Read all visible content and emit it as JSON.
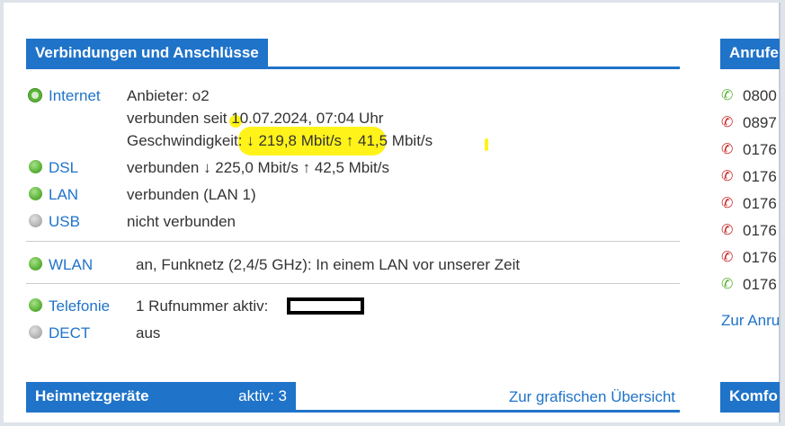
{
  "connections": {
    "title": "Verbindungen und Anschlüsse",
    "internet": {
      "label": "Internet",
      "provider": "Anbieter: o2",
      "since": "verbunden seit 10.07.2024, 07:04 Uhr",
      "speed": "Geschwindigkeit: ↓ 219,8 Mbit/s ↑ 41,5 Mbit/s"
    },
    "dsl": {
      "label": "DSL",
      "status": "verbunden ↓ 225,0 Mbit/s ↑ 42,5 Mbit/s"
    },
    "lan": {
      "label": "LAN",
      "status": "verbunden (LAN 1)"
    },
    "usb": {
      "label": "USB",
      "status": "nicht verbunden"
    },
    "wlan": {
      "label": "WLAN",
      "status": "an, Funknetz (2,4/5 GHz): In einem LAN vor unserer Zeit"
    },
    "telefonie": {
      "label": "Telefonie",
      "status": "1 Rufnummer aktiv:"
    },
    "dect": {
      "label": "DECT",
      "status": "aus"
    }
  },
  "home_network": {
    "title": "Heimnetzgeräte",
    "active": "aktiv: 3",
    "overview_link": "Zur grafischen Übersicht"
  },
  "calls": {
    "title": "Anrufe",
    "items": [
      {
        "number": "0800",
        "type": "incoming",
        "icon": "phone-incoming-icon"
      },
      {
        "number": "0897",
        "type": "missed",
        "icon": "phone-missed-icon"
      },
      {
        "number": "0176",
        "type": "missed",
        "icon": "phone-missed-icon"
      },
      {
        "number": "0176",
        "type": "missed",
        "icon": "phone-missed-icon"
      },
      {
        "number": "0176",
        "type": "missed",
        "icon": "phone-missed-icon"
      },
      {
        "number": "0176",
        "type": "missed",
        "icon": "phone-missed-icon"
      },
      {
        "number": "0176",
        "type": "missed",
        "icon": "phone-missed-icon"
      },
      {
        "number": "0176",
        "type": "incoming",
        "icon": "phone-incoming-icon"
      }
    ],
    "link": "Zur Anru"
  },
  "comfort": {
    "title": "Komfo"
  },
  "colors": {
    "accent": "#1f73c9",
    "ok": "#5cb338",
    "missed": "#c92a2a",
    "highlight": "#fff200"
  }
}
